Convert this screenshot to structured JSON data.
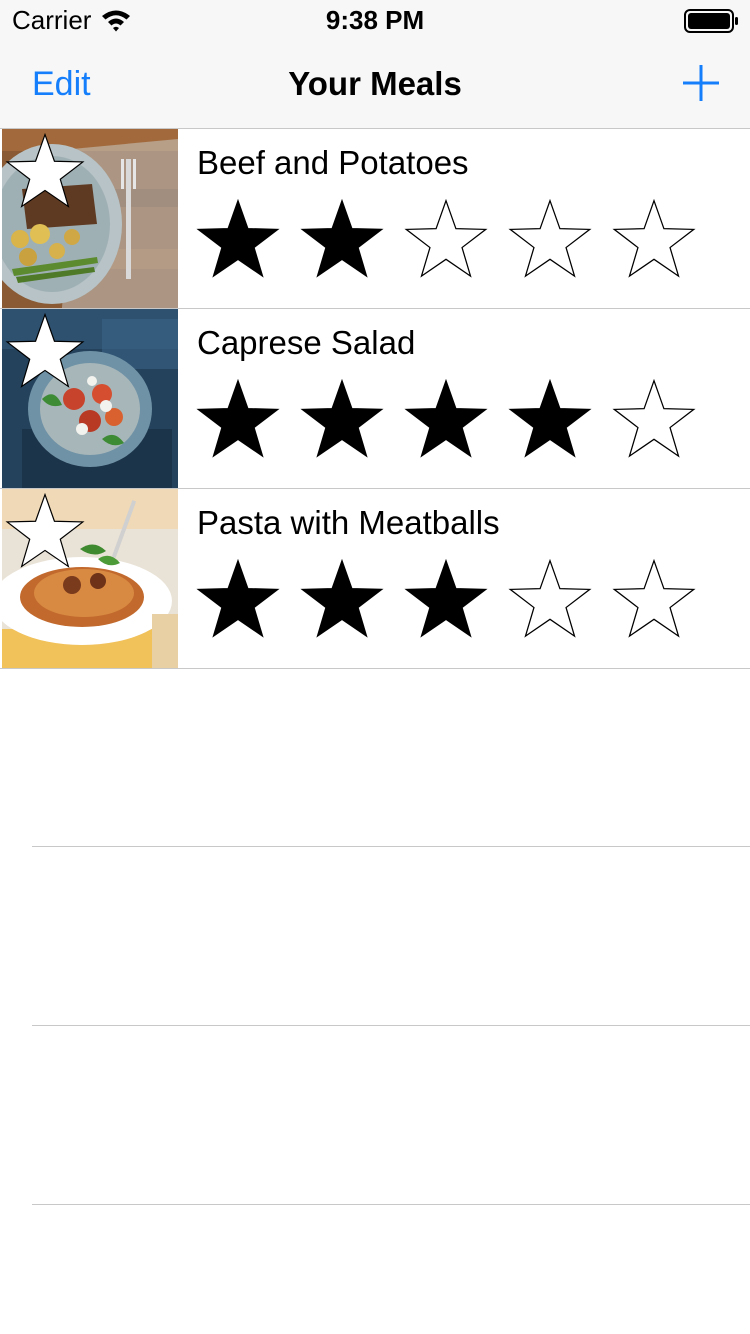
{
  "status_bar": {
    "carrier": "Carrier",
    "time": "9:38 PM",
    "icons": [
      "wifi-icon",
      "battery-icon"
    ]
  },
  "nav_bar": {
    "edit_label": "Edit",
    "title": "Your Meals",
    "add_icon": "plus-icon"
  },
  "colors": {
    "accent": "#147efb",
    "bar_background": "#f7f7f7",
    "separator": "#c8c8c8"
  },
  "meals": [
    {
      "name": "Beef and Potatoes",
      "rating": 2,
      "max_rating": 5,
      "photo": "photo-beef-and-potatoes"
    },
    {
      "name": "Caprese Salad",
      "rating": 4,
      "max_rating": 5,
      "photo": "photo-caprese-salad"
    },
    {
      "name": "Pasta with Meatballs",
      "rating": 3,
      "max_rating": 5,
      "photo": "photo-pasta-with-meatballs"
    }
  ]
}
